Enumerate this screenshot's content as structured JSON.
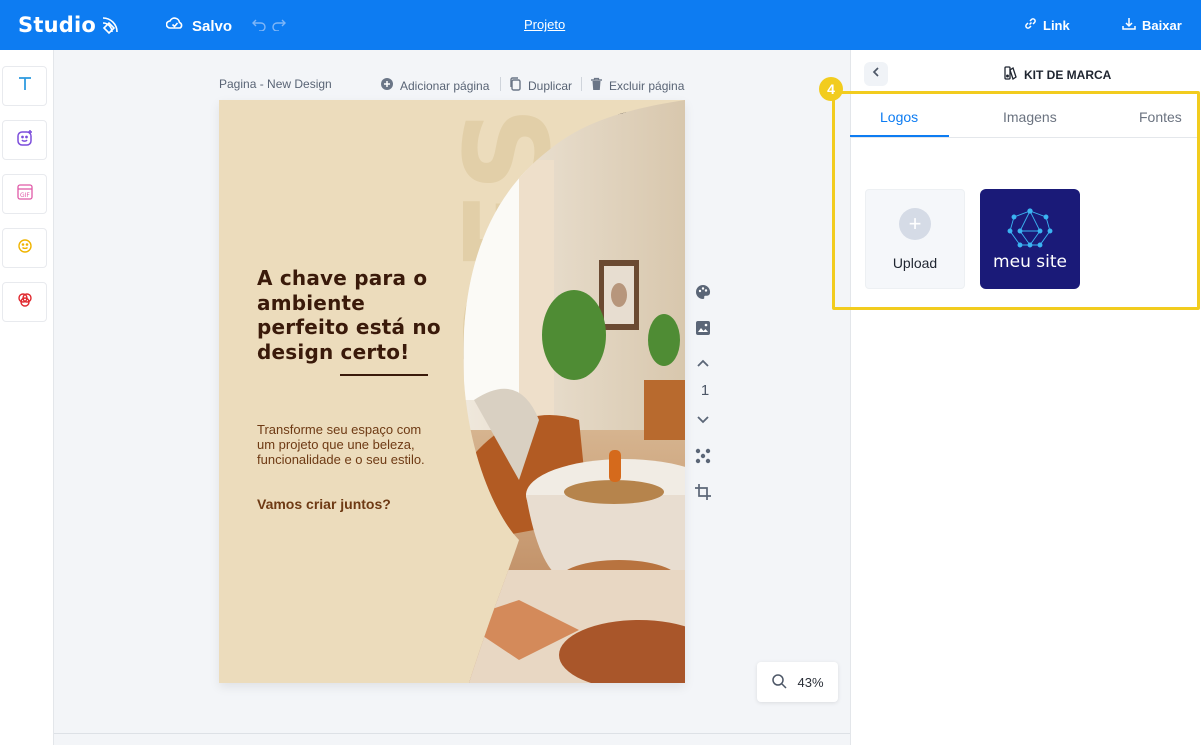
{
  "header": {
    "brand": "Studio",
    "save_status": "Salvo",
    "project_title": "Projeto",
    "link_label": "Link",
    "download_label": "Baixar"
  },
  "left_tools": [
    {
      "name": "text-tool",
      "icon": "text-T-icon"
    },
    {
      "name": "elements-tool",
      "icon": "sticker-add-icon"
    },
    {
      "name": "gif-tool",
      "icon": "gif-icon"
    },
    {
      "name": "emoji-tool",
      "icon": "smiley-icon"
    },
    {
      "name": "shapes-tool",
      "icon": "circles-icon"
    }
  ],
  "canvas": {
    "page_label": "Pagina - New Design",
    "add_page": "Adicionar página",
    "duplicate": "Duplicar",
    "delete_page": "Excluir página",
    "page_number": "1",
    "zoom": "43%"
  },
  "design": {
    "background_word": "DESIGN",
    "headline": "A chave para o ambiente perfeito está no design certo!",
    "body": "Transforme seu espaço com um projeto que une beleza, funcionalidade e o seu estilo.",
    "cta": "Vamos criar juntos?"
  },
  "panel": {
    "title": "KIT DE MARCA",
    "tabs": [
      "Logos",
      "Imagens",
      "Fontes"
    ],
    "active_tab": "Logos",
    "step_number": "4",
    "upload_label": "Upload",
    "logo_text": "meu site"
  },
  "colors": {
    "primary": "#0d7cf2",
    "highlight": "#f2cc1e",
    "design_bg": "#ecdcbc",
    "headline": "#3a1a0a",
    "logo_bg": "#1a1a78"
  }
}
